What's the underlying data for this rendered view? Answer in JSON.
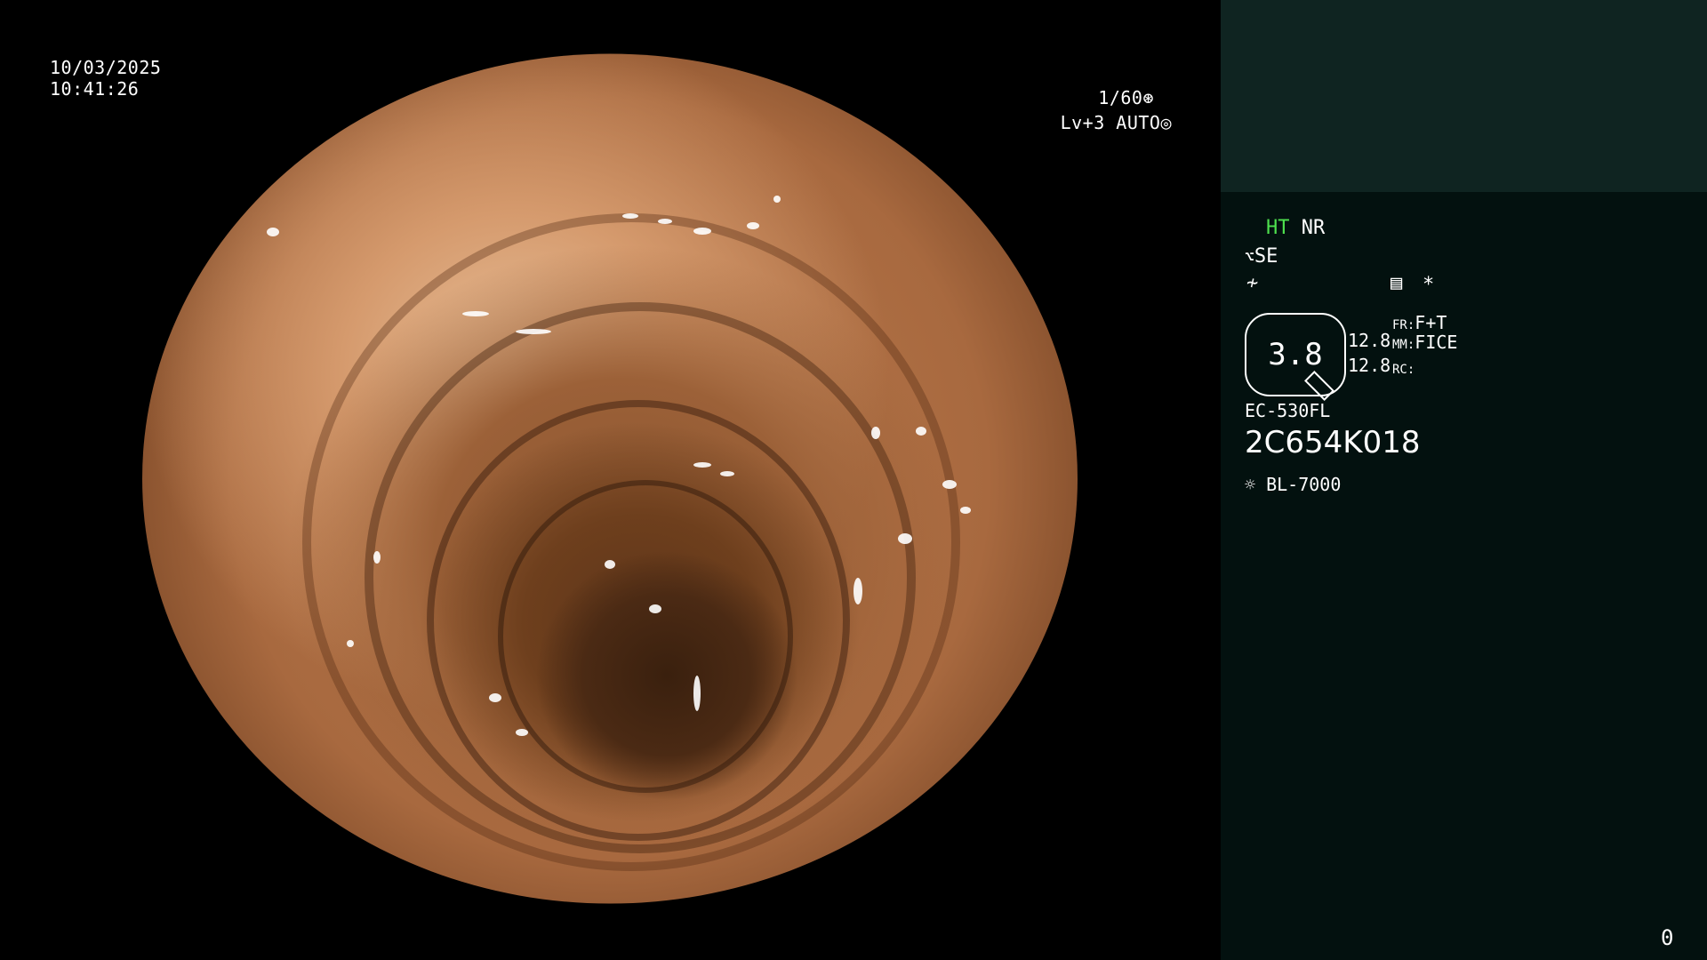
{
  "overlay": {
    "date": "10/03/2025",
    "time": "10:41:26",
    "shutter": "1/60",
    "iris": "Lv+3 AUTO"
  },
  "panel": {
    "ht": "HT",
    "nr": "NR",
    "se": "SE",
    "zoom": "3.8",
    "val1": "12.8",
    "val2": "12.8",
    "fr_label": "FR:",
    "fr_value": "F+T",
    "mm_label": "MM:",
    "mm_value": "FICE",
    "rc_label": "RC:",
    "model": "EC-530FL",
    "serial": "2C654K018",
    "light_source": "BL-7000",
    "counter": "0",
    "asterisk": "*"
  },
  "icons": {
    "shutter_icon": "shutter-icon",
    "iris_icon": "iris-icon",
    "structure_icon": "structure-enhance-icon",
    "color_icon": "color-mode-icon",
    "menu_icon": "menu-icon",
    "light_icon": "light-source-icon"
  }
}
